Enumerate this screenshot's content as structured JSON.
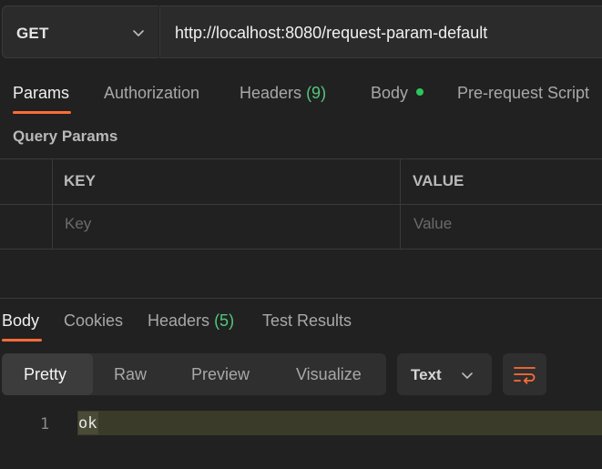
{
  "request": {
    "method": "GET",
    "url": "http://localhost:8080/request-param-default"
  },
  "request_tabs": [
    {
      "label": "Params",
      "active": true
    },
    {
      "label": "Authorization"
    },
    {
      "label": "Headers",
      "count": "(9)"
    },
    {
      "label": "Body",
      "indicator": true
    },
    {
      "label": "Pre-request Script"
    }
  ],
  "query_params": {
    "title": "Query Params",
    "columns": [
      "KEY",
      "VALUE"
    ],
    "placeholder_key": "Key",
    "placeholder_value": "Value"
  },
  "response": {
    "tabs": [
      {
        "label": "Body",
        "active": true
      },
      {
        "label": "Cookies"
      },
      {
        "label": "Headers",
        "count": "(5)"
      },
      {
        "label": "Test Results"
      }
    ],
    "views": [
      "Pretty",
      "Raw",
      "Preview",
      "Visualize"
    ],
    "active_view": "Pretty",
    "format": "Text",
    "lines": [
      {
        "number": "1",
        "text": "ok"
      }
    ]
  },
  "colors": {
    "accent": "#ff6c37",
    "count": "#52c77b",
    "indicator": "#2cc55c"
  },
  "icons": [
    "chevron-down-icon",
    "wrap-lines-icon"
  ]
}
